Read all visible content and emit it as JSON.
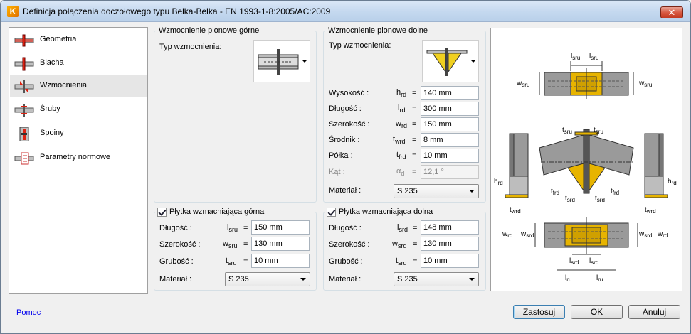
{
  "window": {
    "title": "Definicja połączenia doczołowego typu Belka-Belka - EN 1993-1-8:2005/AC:2009",
    "close_glyph": "✕"
  },
  "nav": {
    "items": [
      {
        "label": "Geometria",
        "icon": "geometry-icon"
      },
      {
        "label": "Blacha",
        "icon": "plate-icon"
      },
      {
        "label": "Wzmocnienia",
        "icon": "stiffener-icon",
        "selected": true
      },
      {
        "label": "Śruby",
        "icon": "bolts-icon"
      },
      {
        "label": "Spoiny",
        "icon": "welds-icon"
      },
      {
        "label": "Parametry normowe",
        "icon": "code-params-icon"
      }
    ]
  },
  "upper_stiff": {
    "title": "Wzmocnienie pionowe górne",
    "type_label": "Typ wzmocnienia:"
  },
  "lower_stiff": {
    "title": "Wzmocnienie pionowe dolne",
    "type_label": "Typ wzmocnienia:",
    "rows": [
      {
        "label": "Wysokość :",
        "sym": "h",
        "sub": "rd",
        "value": "140 mm"
      },
      {
        "label": "Długość :",
        "sym": "l",
        "sub": "rd",
        "value": "300 mm"
      },
      {
        "label": "Szerokość :",
        "sym": "w",
        "sub": "rd",
        "value": "150 mm"
      },
      {
        "label": "Środnik :",
        "sym": "t",
        "sub": "wrd",
        "value": "8 mm"
      },
      {
        "label": "Półka :",
        "sym": "t",
        "sub": "frd",
        "value": "10 mm"
      },
      {
        "label": "Kąt :",
        "sym": "α",
        "sub": "d",
        "value": "12,1 °",
        "disabled": true
      }
    ],
    "material_label": "Materiał :",
    "material_value": "S 235"
  },
  "upper_plate": {
    "checkbox_label": "Płytka wzmacniająca górna",
    "rows": [
      {
        "label": "Długość :",
        "sym": "l",
        "sub": "sru",
        "value": "150 mm"
      },
      {
        "label": "Szerokość :",
        "sym": "w",
        "sub": "sru",
        "value": "130 mm"
      },
      {
        "label": "Grubość :",
        "sym": "t",
        "sub": "sru",
        "value": "10 mm"
      }
    ],
    "material_label": "Materiał :",
    "material_value": "S 235"
  },
  "lower_plate": {
    "checkbox_label": "Płytka wzmacniająca dolna",
    "rows": [
      {
        "label": "Długość :",
        "sym": "l",
        "sub": "srd",
        "value": "148 mm"
      },
      {
        "label": "Szerokość :",
        "sym": "w",
        "sub": "srd",
        "value": "130 mm"
      },
      {
        "label": "Grubość :",
        "sym": "t",
        "sub": "srd",
        "value": "10 mm"
      }
    ],
    "material_label": "Materiał :",
    "material_value": "S 235"
  },
  "diagram": {
    "labels": {
      "l_sru": "l",
      "l_sru_sub": "sru",
      "w_sru": "w",
      "w_sru_sub": "sru",
      "t_sru": "t",
      "t_sru_sub": "sru",
      "h_rd": "h",
      "h_rd_sub": "rd",
      "t_wrd": "t",
      "t_wrd_sub": "wrd",
      "t_frd": "t",
      "t_frd_sub": "frd",
      "t_srd": "t",
      "t_srd_sub": "srd",
      "w_rd": "w",
      "w_rd_sub": "rd",
      "w_srd": "w",
      "w_srd_sub": "srd",
      "l_srd": "l",
      "l_srd_sub": "srd",
      "l_ru": "l",
      "l_ru_sub": "ru"
    }
  },
  "footer": {
    "help_link": "Pomoc",
    "apply_label": "Zastosuj",
    "ok_label": "OK",
    "cancel_label": "Anuluj"
  }
}
